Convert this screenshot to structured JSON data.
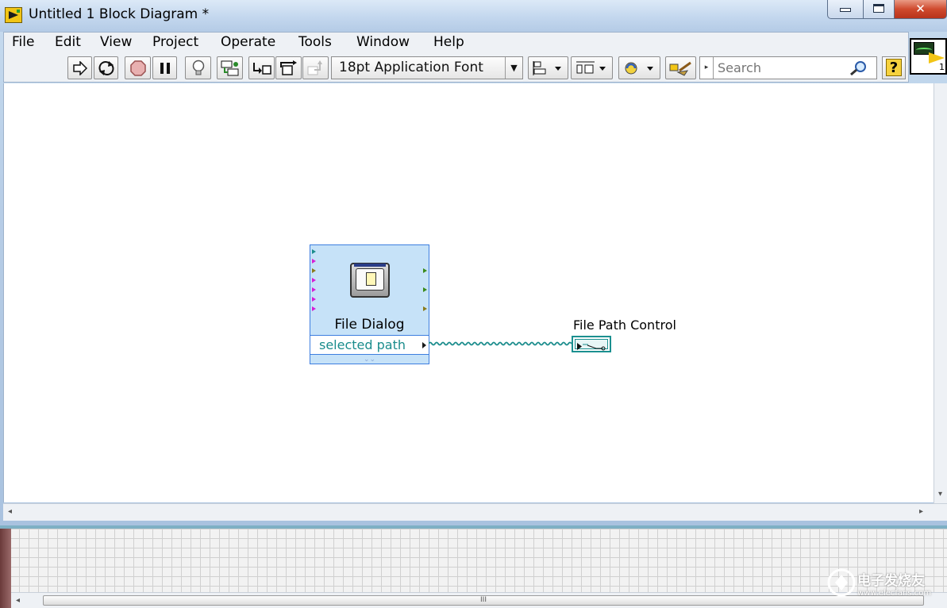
{
  "window": {
    "title": "Untitled 1 Block Diagram *",
    "close_glyph": "✕"
  },
  "menu": {
    "items": [
      "File",
      "Edit",
      "View",
      "Project",
      "Operate",
      "Tools",
      "Window",
      "Help"
    ]
  },
  "toolbar": {
    "font": "18pt Application Font",
    "search_placeholder": "Search",
    "help_glyph": "?"
  },
  "diagram": {
    "express_vi_label": "File Dialog",
    "express_vi_output": "selected path",
    "expand_glyph": "⌄⌄",
    "indicator_label": "File Path Control"
  },
  "lower_scroll_grip": "III",
  "watermark": {
    "name": "电子发烧友",
    "url": "www.elecfans.com"
  },
  "colors": {
    "express_vi_fill": "#c6e2f8",
    "express_vi_border": "#3d7ee0",
    "path_wire": "#1a8c8c"
  }
}
